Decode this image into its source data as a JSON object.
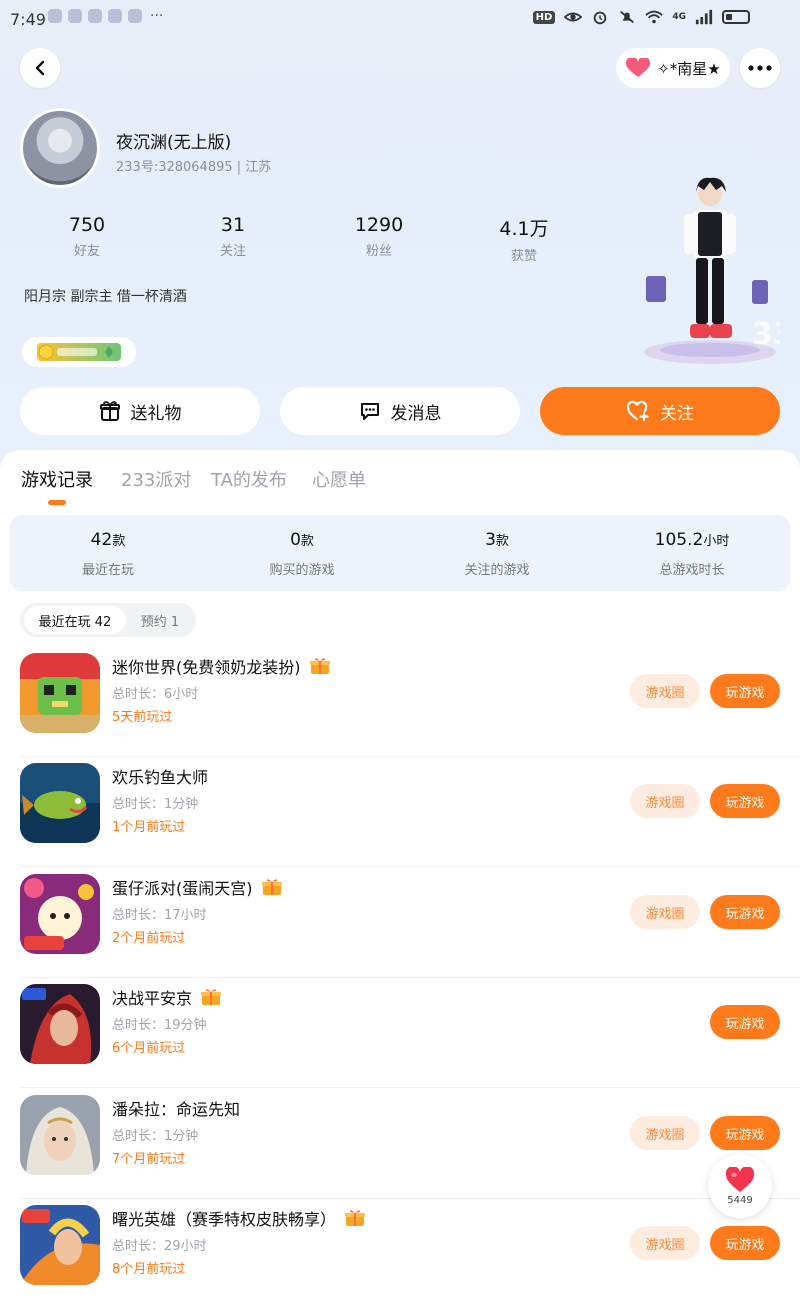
{
  "status_bar": {
    "time": "7:49",
    "more": "···",
    "hd": "HD",
    "network": "4G"
  },
  "header": {
    "friend_name": "✧*南星★"
  },
  "profile": {
    "name": "夜沉渊(无上版)",
    "id_line": "233号:328064895 | 江苏",
    "stats": [
      {
        "value": "750",
        "label": "好友"
      },
      {
        "value": "31",
        "label": "关注"
      },
      {
        "value": "1290",
        "label": "粉丝"
      },
      {
        "value": "4.1万",
        "label": "获赞"
      }
    ],
    "bio": "阳月宗 副宗主  借一杯清酒"
  },
  "actions": {
    "gift": "送礼物",
    "message": "发消息",
    "follow": "关注"
  },
  "tabs": [
    "游戏记录",
    "233派对",
    "TA的发布",
    "心愿单"
  ],
  "summary": [
    {
      "value": "42",
      "unit": "款",
      "label": "最近在玩"
    },
    {
      "value": "0",
      "unit": "款",
      "label": "购买的游戏"
    },
    {
      "value": "3",
      "unit": "款",
      "label": "关注的游戏"
    },
    {
      "value": "105.2",
      "unit": "小时",
      "label": "总游戏时长"
    }
  ],
  "filters": {
    "recent": "最近在玩 42",
    "reserve": "预约 1"
  },
  "game_buttons": {
    "circle": "游戏圈",
    "play": "玩游戏"
  },
  "games": [
    {
      "name": "迷你世界(免费领奶龙装扮)",
      "duration": "总时长：6小时",
      "last": "5天前玩过"
    },
    {
      "name": "欢乐钓鱼大师",
      "duration": "总时长：1分钟",
      "last": "1个月前玩过"
    },
    {
      "name": "蛋仔派对(蛋闹天宫)",
      "duration": "总时长：17小时",
      "last": "2个月前玩过"
    },
    {
      "name": "决战平安京",
      "duration": "总时长：19分钟",
      "last": "6个月前玩过"
    },
    {
      "name": "潘朵拉：命运先知",
      "duration": "总时长：1分钟",
      "last": "7个月前玩过"
    },
    {
      "name": "曙光英雄（赛季特权皮肤畅享）",
      "duration": "总时长：29小时",
      "last": "8个月前玩过"
    }
  ],
  "like_count": "5449",
  "colors": {
    "accent": "#ff7a1a",
    "circle_bg": "#feece0"
  }
}
